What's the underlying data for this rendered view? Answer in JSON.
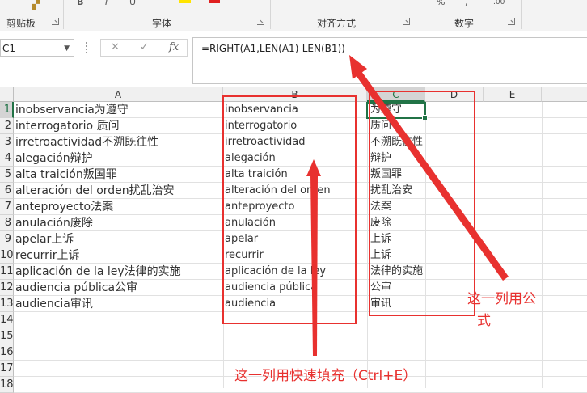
{
  "ribbon": {
    "groups": [
      "剪贴板",
      "字体",
      "对齐方式",
      "数字"
    ],
    "font_controls": [
      "B",
      "I",
      "U"
    ],
    "number_icons": [
      "%",
      ",",
      ".00"
    ]
  },
  "formula_bar": {
    "name_box": "C1",
    "cancel_icon": "✕",
    "enter_icon": "✓",
    "fx_label": "fx",
    "formula": "=RIGHT(A1,LEN(A1)-LEN(B1))"
  },
  "sheet": {
    "columns": [
      "A",
      "B",
      "C",
      "D",
      "E"
    ],
    "row_numbers": [
      "1",
      "2",
      "3",
      "4",
      "5",
      "6",
      "7",
      "8",
      "9",
      "10",
      "11",
      "12",
      "13",
      "14",
      "15",
      "16",
      "17",
      "18"
    ],
    "col_a": [
      "inobservancia为遵守",
      "interrogatorio 质问",
      "irretroactividad不溯既往性",
      "alegación辩护",
      "alta traición叛国罪",
      "alteración del orden扰乱治安",
      "anteproyecto法案",
      "anulación废除",
      "apelar上诉",
      "recurrir上诉",
      "aplicación de la ley法律的实施",
      "audiencia pública公审",
      "audiencia审讯"
    ],
    "col_b": [
      "inobservancia",
      "interrogatorio",
      "irretroactividad",
      "alegación",
      "alta traición",
      "alteración del orden",
      "anteproyecto",
      "anulación",
      "apelar",
      "recurrir",
      "aplicación de la ley",
      "audiencia pública",
      "audiencia"
    ],
    "col_c": [
      "为遵守",
      "质问",
      "不溯既往性",
      "辩护",
      "叛国罪",
      "扰乱治安",
      "法案",
      "废除",
      "上诉",
      "上诉",
      "法律的实施",
      "公审",
      "审讯"
    ]
  },
  "annotations": {
    "flash_fill_note": "这一列用快速填充（Ctrl+E）",
    "formula_note_line1": "这一列用公",
    "formula_note_line2": "式"
  },
  "colors": {
    "annotation_red": "#e8312f",
    "excel_green": "#217346"
  }
}
